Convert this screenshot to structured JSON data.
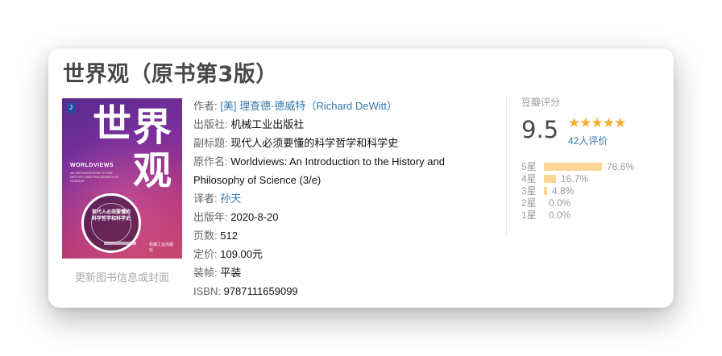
{
  "book": {
    "title": "世界观（原书第3版）",
    "cover": {
      "title_chars": [
        "世",
        "界",
        "观"
      ],
      "badge": "J",
      "english_title": "WORLDVIEWS",
      "english_subtitle": "AN INTRODUCTION TO THE HISTORY AND PHILOSOPHY OF SCIENCE",
      "ring_text_1": "现代人必须要懂的",
      "ring_text_2": "科学哲学和科学史",
      "publisher_mark": "机械工业出版社"
    },
    "update_link": "更新图书信息或封面"
  },
  "info": {
    "author_label": "作者:",
    "author_value": "[美] 理查德·德威特（Richard DeWitt）",
    "publisher_label": "出版社:",
    "publisher_value": "机械工业出版社",
    "subtitle_label": "副标题:",
    "subtitle_value": "现代人必须要懂的科学哲学和科学史",
    "original_label": "原作名:",
    "original_value": "Worldviews: An Introduction to the History and Philosophy of Science (3/e)",
    "translator_label": "译者:",
    "translator_value": "孙天",
    "pubdate_label": "出版年:",
    "pubdate_value": "2020-8-20",
    "pages_label": "页数:",
    "pages_value": "512",
    "price_label": "定价:",
    "price_value": "109.00元",
    "binding_label": "装帧:",
    "binding_value": "平装",
    "isbn_label": "ISBN:",
    "isbn_value": "9787111659099"
  },
  "rating": {
    "label": "豆瓣评分",
    "score": "9.5",
    "stars": "★★★★★",
    "count": "42人评价",
    "distribution": [
      {
        "star": "5星",
        "percent": "78.6%",
        "value": 78.6
      },
      {
        "star": "4星",
        "percent": "16.7%",
        "value": 16.7
      },
      {
        "star": "3星",
        "percent": "4.8%",
        "value": 4.8
      },
      {
        "star": "2星",
        "percent": "0.0%",
        "value": 0.0
      },
      {
        "star": "1星",
        "percent": "0.0%",
        "value": 0.0
      }
    ]
  },
  "colors": {
    "link": "#3377aa",
    "star": "#ffac2d",
    "bar": "#ffd596"
  }
}
